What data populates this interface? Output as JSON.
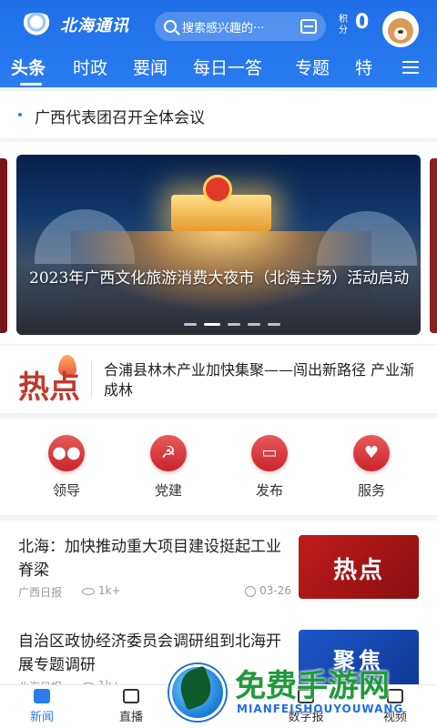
{
  "header": {
    "logo_text": "北海通讯",
    "search_placeholder": "搜索感兴趣的···",
    "points_label": "积分",
    "points_value": "0"
  },
  "tabs": [
    "头条",
    "时政",
    "要闻",
    "每日一答",
    "专题",
    "特"
  ],
  "headline": "广西代表团召开全体会议",
  "carousel": {
    "caption": "2023年广西文化旅游消费大夜市（北海主场）活动启动",
    "active_dot": 2,
    "dot_count": 5
  },
  "hot": {
    "badge": "热点",
    "text": "合浦县林木产业加快集聚——闯出新路径 产业渐成林"
  },
  "services": [
    {
      "label": "领导",
      "icon": "people-icon"
    },
    {
      "label": "党建",
      "icon": "party-emblem-icon"
    },
    {
      "label": "发布",
      "icon": "podium-icon"
    },
    {
      "label": "服务",
      "icon": "heart-hand-icon"
    }
  ],
  "news": [
    {
      "title": "北海：加快推动重大项目建设挺起工业脊梁",
      "source": "广西日报",
      "views": "1k+",
      "time": "03-26",
      "thumb_text": "热点"
    },
    {
      "title": "自治区政协经济委员会调研组到北海开展专题调研",
      "source": "北海日报",
      "views": "1k+",
      "time": "",
      "thumb_text": "聚焦"
    }
  ],
  "bottom_nav": [
    {
      "label": "新闻",
      "active": true
    },
    {
      "label": "直播",
      "active": false
    },
    {
      "label": "数字报",
      "active": false
    },
    {
      "label": "视频",
      "active": false
    }
  ],
  "watermark": {
    "text": "免费手游网",
    "sub": "MIANFEISHOUYOUWANG"
  },
  "colors": {
    "brand_blue": "#2a7cf0",
    "accent_red": "#c8242a"
  }
}
